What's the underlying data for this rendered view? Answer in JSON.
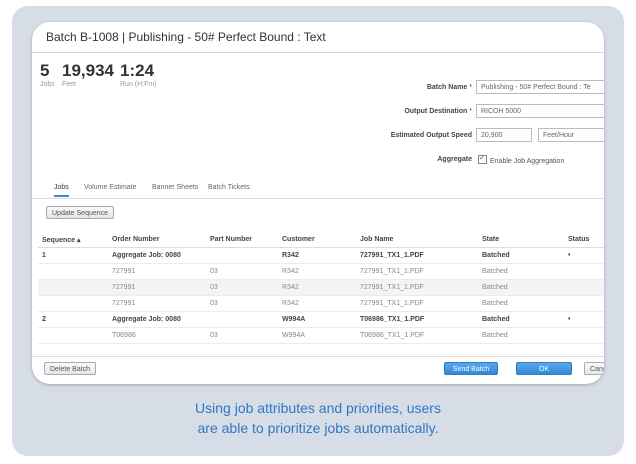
{
  "caption": {
    "line1": "Using job attributes and priorities, users",
    "line2": "are able to prioritize jobs automatically."
  },
  "window": {
    "title": "Batch  B-1008  |  Publishing - 50# Perfect Bound : Text"
  },
  "stats": [
    {
      "value": "5",
      "label": "Jobs"
    },
    {
      "value": "19,934",
      "label": "Feet"
    },
    {
      "value": "1:24",
      "label": "Run (H:Fm)"
    }
  ],
  "form": {
    "batch_name_label": "Batch Name",
    "batch_name_value": "Publishing - 50# Perfect Bound : Te",
    "output_destination_label": "Output Destination",
    "output_destination_value": "RICOH 5000",
    "estimated_speed_label": "Estimated Output Speed",
    "estimated_speed_value": "20,900",
    "speed_unit_value": "Feet/Hour",
    "aggregate_label": "Aggregate",
    "aggregate_checkbox_label": "Enable Job Aggregation",
    "required_mark": "*"
  },
  "tabs": [
    {
      "label": "Jobs"
    },
    {
      "label": "Volume Estimate"
    },
    {
      "label": "Banner Sheets"
    },
    {
      "label": "Batch Tickets"
    }
  ],
  "toolbar": {
    "update_sequence_label": "Update Sequence"
  },
  "table": {
    "columns": [
      "Sequence ▴",
      "Order Number",
      "Part Number",
      "Customer",
      "Job Name",
      "State",
      "Status"
    ],
    "rows": [
      {
        "kind": "agg",
        "cells": [
          "1",
          "Aggregate Job: 0080",
          "",
          "R342",
          "727991_TX1_1.PDF",
          "Batched",
          "•"
        ]
      },
      {
        "kind": "sub",
        "cells": [
          "",
          "727991",
          "03",
          "R342",
          "727991_TX1_1.PDF",
          "Batched",
          ""
        ]
      },
      {
        "kind": "sub alt",
        "cells": [
          "",
          "727991",
          "03",
          "R342",
          "727991_TX1_1.PDF",
          "Batched",
          ""
        ]
      },
      {
        "kind": "sub",
        "cells": [
          "",
          "727991",
          "03",
          "R342",
          "727991_TX1_1.PDF",
          "Batched",
          ""
        ]
      },
      {
        "kind": "agg",
        "cells": [
          "2",
          "Aggregate Job: 0080",
          "",
          "W994A",
          "T06986_TX1_1.PDF",
          "Batched",
          "•"
        ]
      },
      {
        "kind": "sub",
        "cells": [
          "",
          "T06986",
          "03",
          "W994A",
          "T06986_TX1_1.PDF",
          "Batched",
          ""
        ]
      }
    ]
  },
  "footer": {
    "delete_label": "Delete Batch",
    "send_label": "Send Batch",
    "ok_label": "OK",
    "cancel_label": "Cancel"
  }
}
